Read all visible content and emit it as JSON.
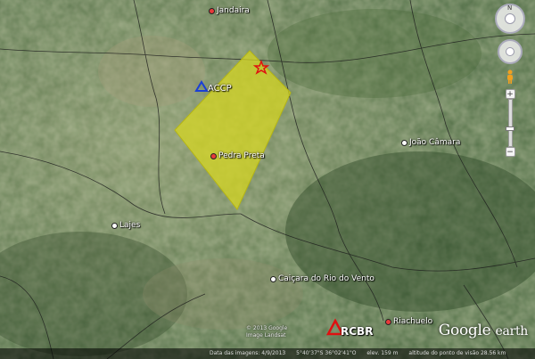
{
  "places": [
    {
      "id": "jandaira",
      "label": "Jandaira",
      "marker": "red"
    },
    {
      "id": "pedra-preta",
      "label": "Pedra Preta",
      "marker": "red"
    },
    {
      "id": "joao-camara",
      "label": "João Câmara",
      "marker": "white"
    },
    {
      "id": "lajes",
      "label": "Lajes",
      "marker": "white"
    },
    {
      "id": "caicara",
      "label": "Caiçara do Rio do Vento",
      "marker": "white"
    },
    {
      "id": "riachuelo",
      "label": "Riachuelo",
      "marker": "red"
    }
  ],
  "stations": {
    "accp": {
      "label": "ACCP",
      "icon": "blue-triangle-icon",
      "color": "#1a3fd6"
    },
    "rcbr": {
      "label": "RCBR",
      "icon": "red-triangle-icon",
      "color": "#e01010"
    },
    "epicenter": {
      "icon": "red-star-icon",
      "color": "#e01010"
    }
  },
  "region": {
    "fill": "#d8d81e"
  },
  "brand": {
    "google": "Google",
    "earth": "earth"
  },
  "copyright": {
    "line1": "© 2013 Google",
    "line2": "Image Landsat"
  },
  "statusbar": {
    "date": "Data das imagens: 4/9/2013",
    "coords": "5°40'37\"S  36°02'41\"O",
    "elev": "elev. 159 m",
    "eye": "altitude do ponto de visão 28.56 km"
  },
  "controls": {
    "north": "N",
    "zoom_in": "+",
    "zoom_out": "−"
  }
}
